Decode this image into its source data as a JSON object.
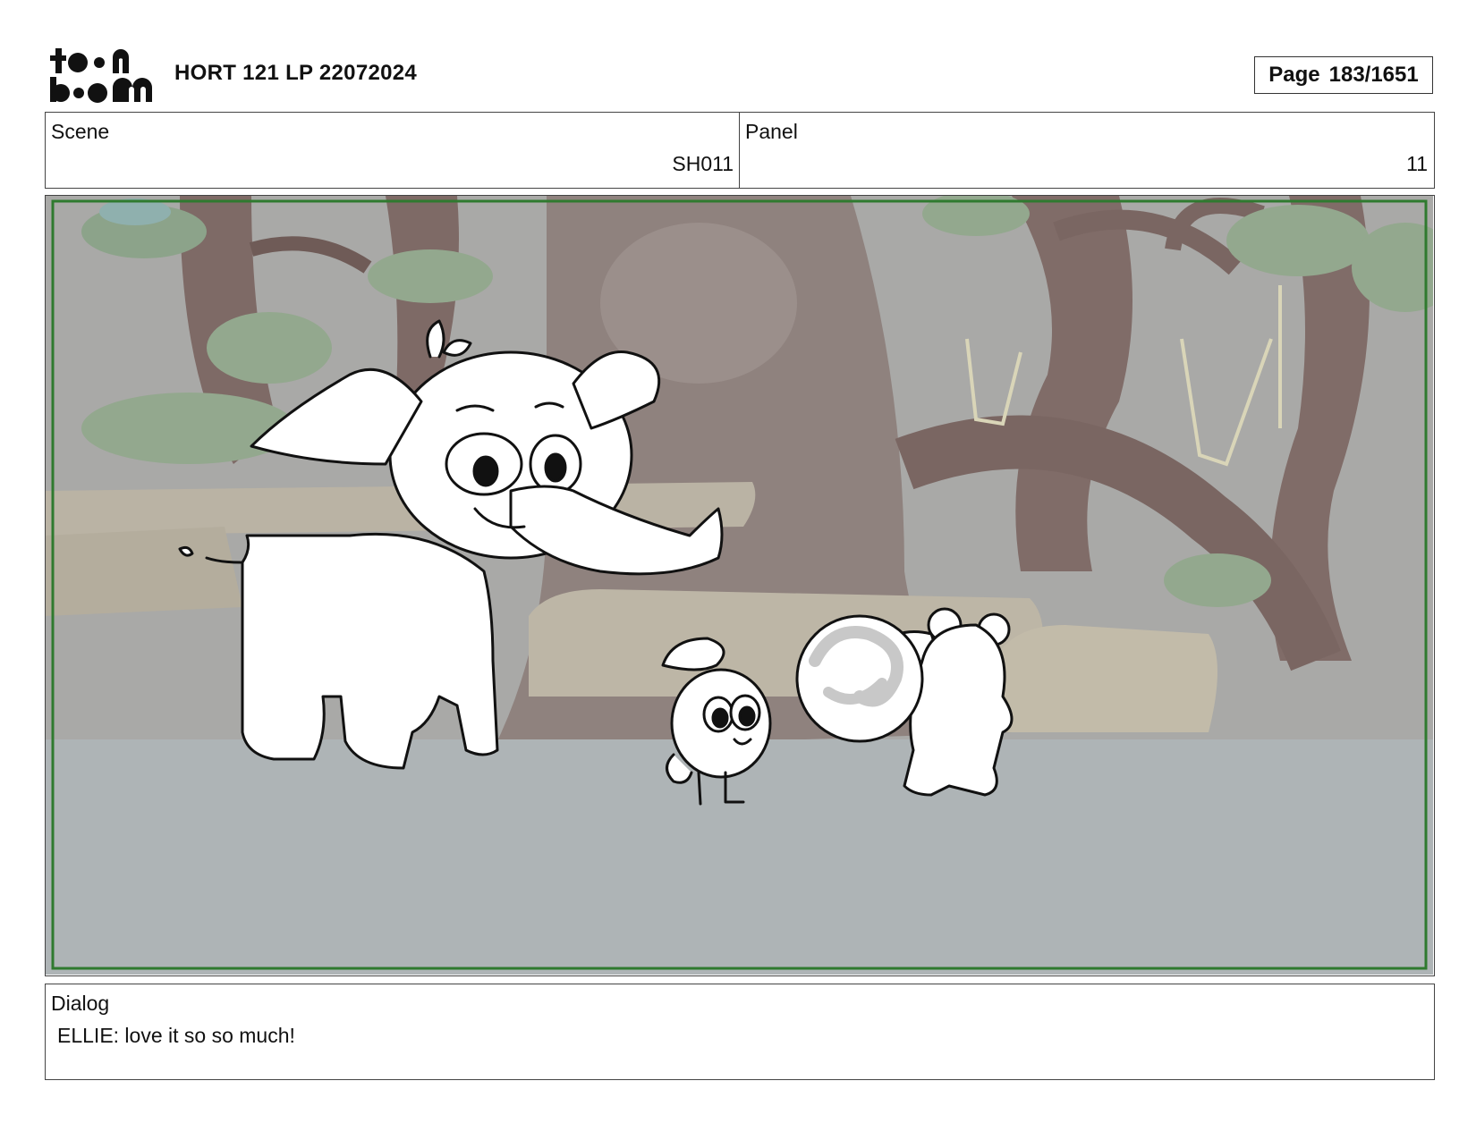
{
  "header": {
    "logo_text": "toon boom",
    "project_title": "HORT 121 LP 22072024",
    "page_label": "Page",
    "page_value": "183/1651"
  },
  "info": {
    "scene_label": "Scene",
    "scene_value": "SH011",
    "panel_label": "Panel",
    "panel_value": "11"
  },
  "dialog": {
    "label": "Dialog",
    "text": "ELLIE: love it so so much!"
  },
  "colors": {
    "frame_border": "#2f7a2f",
    "background_grey": "#a9a9a7",
    "floor": "#aeb4b6",
    "tree_brown": "#8a7470"
  }
}
